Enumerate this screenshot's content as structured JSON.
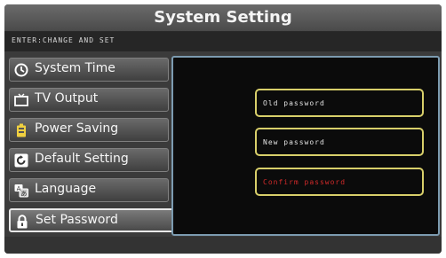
{
  "window": {
    "title": "System Setting"
  },
  "hint": {
    "text": "ENTER:CHANGE AND SET"
  },
  "menu": {
    "items": [
      {
        "label": "System Time",
        "icon": "clock-icon",
        "selected": false
      },
      {
        "label": "TV Output",
        "icon": "tv-icon",
        "selected": false
      },
      {
        "label": "Power Saving",
        "icon": "battery-icon",
        "selected": false
      },
      {
        "label": "Default Setting",
        "icon": "reset-icon",
        "selected": false
      },
      {
        "label": "Language",
        "icon": "language-icon",
        "selected": false
      },
      {
        "label": "Set Password",
        "icon": "lock-icon",
        "selected": true
      }
    ]
  },
  "password_panel": {
    "old_placeholder": "Old password",
    "new_placeholder": "New password",
    "confirm_placeholder": "Confirm password"
  },
  "colors": {
    "field_border": "#d8cf6a",
    "active_text": "#d22a2a",
    "panel_border": "#7c9bb0"
  }
}
